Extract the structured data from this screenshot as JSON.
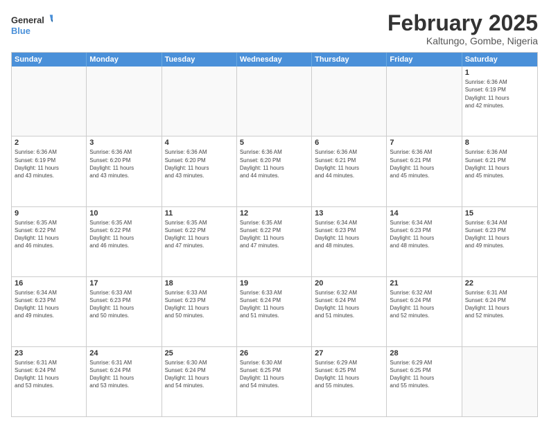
{
  "logo": {
    "line1": "General",
    "line2": "Blue"
  },
  "title": "February 2025",
  "subtitle": "Kaltungo, Gombe, Nigeria",
  "header": {
    "days": [
      "Sunday",
      "Monday",
      "Tuesday",
      "Wednesday",
      "Thursday",
      "Friday",
      "Saturday"
    ]
  },
  "weeks": [
    [
      {
        "day": "",
        "info": ""
      },
      {
        "day": "",
        "info": ""
      },
      {
        "day": "",
        "info": ""
      },
      {
        "day": "",
        "info": ""
      },
      {
        "day": "",
        "info": ""
      },
      {
        "day": "",
        "info": ""
      },
      {
        "day": "1",
        "info": "Sunrise: 6:36 AM\nSunset: 6:19 PM\nDaylight: 11 hours\nand 42 minutes."
      }
    ],
    [
      {
        "day": "2",
        "info": "Sunrise: 6:36 AM\nSunset: 6:19 PM\nDaylight: 11 hours\nand 43 minutes."
      },
      {
        "day": "3",
        "info": "Sunrise: 6:36 AM\nSunset: 6:20 PM\nDaylight: 11 hours\nand 43 minutes."
      },
      {
        "day": "4",
        "info": "Sunrise: 6:36 AM\nSunset: 6:20 PM\nDaylight: 11 hours\nand 43 minutes."
      },
      {
        "day": "5",
        "info": "Sunrise: 6:36 AM\nSunset: 6:20 PM\nDaylight: 11 hours\nand 44 minutes."
      },
      {
        "day": "6",
        "info": "Sunrise: 6:36 AM\nSunset: 6:21 PM\nDaylight: 11 hours\nand 44 minutes."
      },
      {
        "day": "7",
        "info": "Sunrise: 6:36 AM\nSunset: 6:21 PM\nDaylight: 11 hours\nand 45 minutes."
      },
      {
        "day": "8",
        "info": "Sunrise: 6:36 AM\nSunset: 6:21 PM\nDaylight: 11 hours\nand 45 minutes."
      }
    ],
    [
      {
        "day": "9",
        "info": "Sunrise: 6:35 AM\nSunset: 6:22 PM\nDaylight: 11 hours\nand 46 minutes."
      },
      {
        "day": "10",
        "info": "Sunrise: 6:35 AM\nSunset: 6:22 PM\nDaylight: 11 hours\nand 46 minutes."
      },
      {
        "day": "11",
        "info": "Sunrise: 6:35 AM\nSunset: 6:22 PM\nDaylight: 11 hours\nand 47 minutes."
      },
      {
        "day": "12",
        "info": "Sunrise: 6:35 AM\nSunset: 6:22 PM\nDaylight: 11 hours\nand 47 minutes."
      },
      {
        "day": "13",
        "info": "Sunrise: 6:34 AM\nSunset: 6:23 PM\nDaylight: 11 hours\nand 48 minutes."
      },
      {
        "day": "14",
        "info": "Sunrise: 6:34 AM\nSunset: 6:23 PM\nDaylight: 11 hours\nand 48 minutes."
      },
      {
        "day": "15",
        "info": "Sunrise: 6:34 AM\nSunset: 6:23 PM\nDaylight: 11 hours\nand 49 minutes."
      }
    ],
    [
      {
        "day": "16",
        "info": "Sunrise: 6:34 AM\nSunset: 6:23 PM\nDaylight: 11 hours\nand 49 minutes."
      },
      {
        "day": "17",
        "info": "Sunrise: 6:33 AM\nSunset: 6:23 PM\nDaylight: 11 hours\nand 50 minutes."
      },
      {
        "day": "18",
        "info": "Sunrise: 6:33 AM\nSunset: 6:23 PM\nDaylight: 11 hours\nand 50 minutes."
      },
      {
        "day": "19",
        "info": "Sunrise: 6:33 AM\nSunset: 6:24 PM\nDaylight: 11 hours\nand 51 minutes."
      },
      {
        "day": "20",
        "info": "Sunrise: 6:32 AM\nSunset: 6:24 PM\nDaylight: 11 hours\nand 51 minutes."
      },
      {
        "day": "21",
        "info": "Sunrise: 6:32 AM\nSunset: 6:24 PM\nDaylight: 11 hours\nand 52 minutes."
      },
      {
        "day": "22",
        "info": "Sunrise: 6:31 AM\nSunset: 6:24 PM\nDaylight: 11 hours\nand 52 minutes."
      }
    ],
    [
      {
        "day": "23",
        "info": "Sunrise: 6:31 AM\nSunset: 6:24 PM\nDaylight: 11 hours\nand 53 minutes."
      },
      {
        "day": "24",
        "info": "Sunrise: 6:31 AM\nSunset: 6:24 PM\nDaylight: 11 hours\nand 53 minutes."
      },
      {
        "day": "25",
        "info": "Sunrise: 6:30 AM\nSunset: 6:24 PM\nDaylight: 11 hours\nand 54 minutes."
      },
      {
        "day": "26",
        "info": "Sunrise: 6:30 AM\nSunset: 6:25 PM\nDaylight: 11 hours\nand 54 minutes."
      },
      {
        "day": "27",
        "info": "Sunrise: 6:29 AM\nSunset: 6:25 PM\nDaylight: 11 hours\nand 55 minutes."
      },
      {
        "day": "28",
        "info": "Sunrise: 6:29 AM\nSunset: 6:25 PM\nDaylight: 11 hours\nand 55 minutes."
      },
      {
        "day": "",
        "info": ""
      }
    ]
  ]
}
